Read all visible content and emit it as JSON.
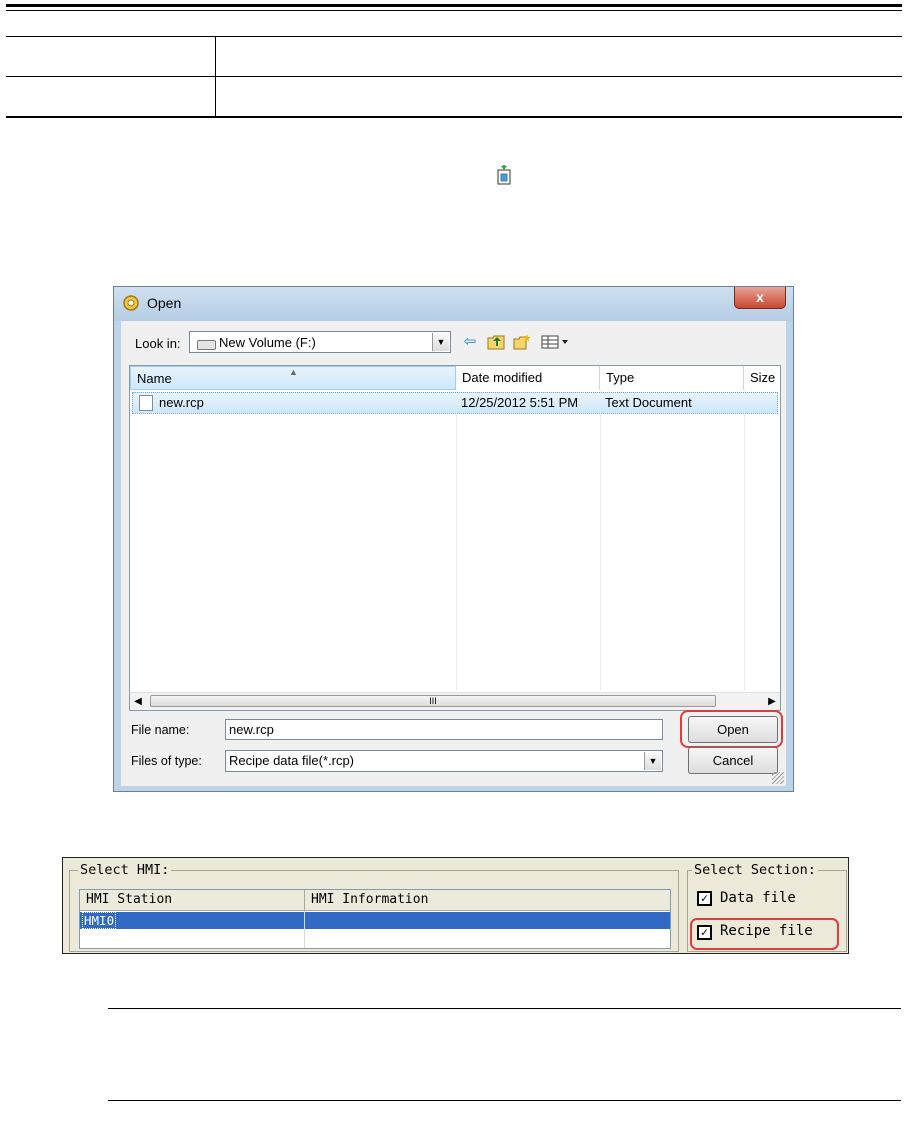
{
  "open_dialog": {
    "title": "Open",
    "close_label": "x",
    "look_in_label": "Look in:",
    "look_in_value": "New Volume (F:)",
    "columns": [
      "Name",
      "Date modified",
      "Type",
      "Size"
    ],
    "files": [
      {
        "name": "new.rcp",
        "date_modified": "12/25/2012 5:51 PM",
        "type": "Text Document",
        "size": ""
      }
    ],
    "scroll_thumb_label": "III",
    "file_name_label": "File name:",
    "file_name_value": "new.rcp",
    "files_of_type_label": "Files of type:",
    "files_of_type_value": "Recipe data file(*.rcp)",
    "open_button": "Open",
    "cancel_button": "Cancel"
  },
  "hmi_panel": {
    "select_hmi_legend": "Select HMI:",
    "columns": [
      "HMI Station",
      "HMI Information"
    ],
    "rows": [
      {
        "station": "HMI0",
        "information": ""
      }
    ],
    "select_section_legend": "Select Section:",
    "data_file_label": "Data file",
    "data_file_checked": true,
    "recipe_file_label": "Recipe file",
    "recipe_file_checked": true
  },
  "colors": {
    "highlight_red": "#e03c3c",
    "selection_blue": "#316ac5",
    "dialog_frame": "#bcd4ea"
  }
}
